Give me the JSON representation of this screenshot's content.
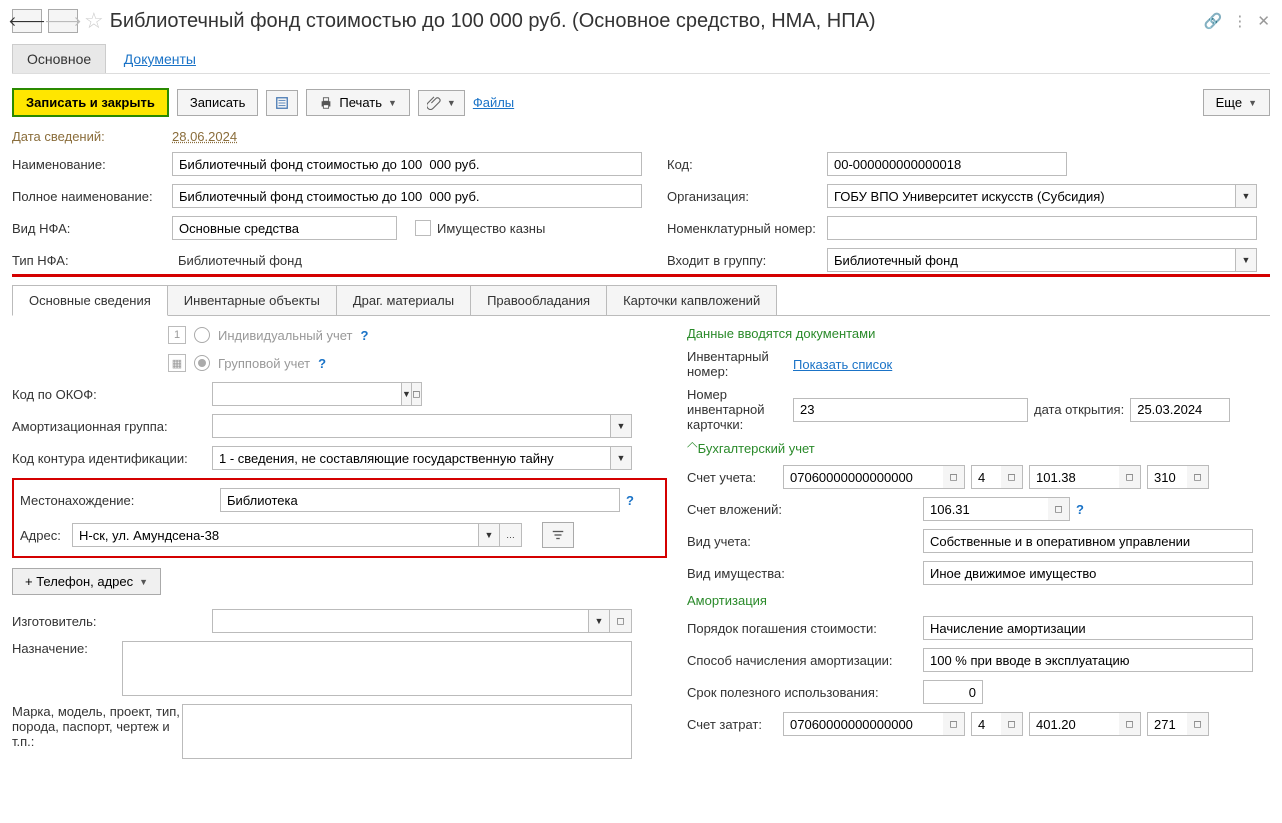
{
  "window_title": "Библиотечный фонд стоимостью до 100  000 руб. (Основное средство, НМА, НПА)",
  "section_tabs": {
    "main": "Основное",
    "docs": "Документы"
  },
  "toolbar": {
    "save_close": "Записать и закрыть",
    "save": "Записать",
    "print": "Печать",
    "files": "Файлы",
    "more": "Еще"
  },
  "fields": {
    "date_label": "Дата сведений:",
    "date_value": "28.06.2024",
    "name_label": "Наименование:",
    "name_value": "Библиотечный фонд стоимостью до 100  000 руб.",
    "fullname_label": "Полное наименование:",
    "fullname_value": "Библиотечный фонд стоимостью до 100  000 руб.",
    "code_label": "Код:",
    "code_value": "00-000000000000018",
    "org_label": "Организация:",
    "org_value": "ГОБУ ВПО Университет искусств (Субсидия)",
    "nfa_kind_label": "Вид НФА:",
    "nfa_kind_value": "Основные средства",
    "treasury_label": "Имущество казны",
    "nom_label": "Номенклатурный номер:",
    "nfa_type_label": "Тип НФА:",
    "nfa_type_value": "Библиотечный фонд",
    "group_label": "Входит в группу:",
    "group_value": "Библиотечный фонд"
  },
  "detail_tabs": {
    "t1": "Основные сведения",
    "t2": "Инвентарные объекты",
    "t3": "Драг. материалы",
    "t4": "Правообладания",
    "t5": "Карточки капвложений"
  },
  "left": {
    "individual": "Индивидуальный учет",
    "group": "Групповой учет",
    "okof_label": "Код по ОКОФ:",
    "amort_group_label": "Амортизационная группа:",
    "ident_label": "Код контура идентификации:",
    "ident_value": "1 - сведения, не составляющие государственную тайну",
    "location_label": "Местонахождение:",
    "location_value": "Библиотека",
    "address_label": "Адрес:",
    "address_value": "Н-ск, ул. Амундсена-38",
    "phone_btn": "+ Телефон, адрес",
    "maker_label": "Изготовитель:",
    "purpose_label": "Назначение:",
    "model_label": "Марка, модель, проект, тип, порода, паспорт, чертеж и т.п.:"
  },
  "right": {
    "docs_header": "Данные вводятся документами",
    "inv_num_label": "Инвентарный номер:",
    "show_list": "Показать список",
    "card_num_label": "Номер инвентарной карточки:",
    "card_num_value": "23",
    "open_date_label": "дата открытия:",
    "open_date_value": "25.03.2024",
    "accounting_header": "Бухгалтерский учет",
    "acc_label": "Счет учета:",
    "acc_v1": "07060000000000000",
    "acc_v2": "4",
    "acc_v3": "101.38",
    "acc_v4": "310",
    "inv_acc_label": "Счет вложений:",
    "inv_acc_value": "106.31",
    "kind_label": "Вид учета:",
    "kind_value": "Собственные и в оперативном управлении",
    "prop_label": "Вид имущества:",
    "prop_value": "Иное движимое имущество",
    "amort_header": "Амортизация",
    "repay_label": "Порядок погашения стоимости:",
    "repay_value": "Начисление амортизации",
    "method_label": "Способ начисления амортизации:",
    "method_value": "100 % при вводе в эксплуатацию",
    "life_label": "Срок полезного использования:",
    "life_value": "0",
    "cost_label": "Счет затрат:",
    "cost_v1": "07060000000000000",
    "cost_v2": "4",
    "cost_v3": "401.20",
    "cost_v4": "271"
  }
}
